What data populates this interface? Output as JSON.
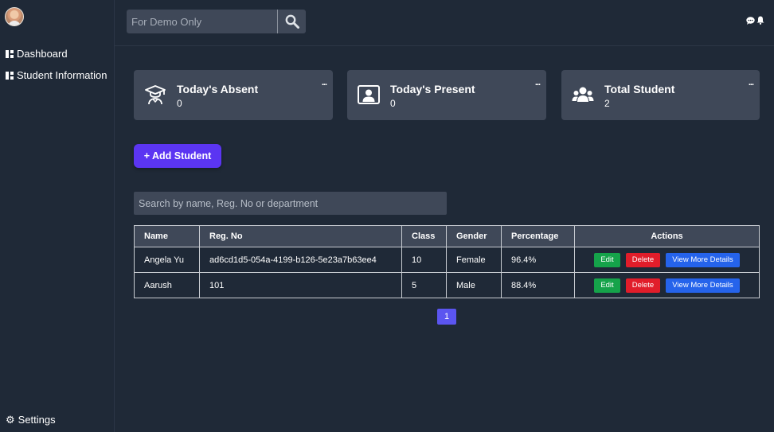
{
  "sidebar": {
    "items": [
      {
        "label": "Dashboard"
      },
      {
        "label": "Student Information"
      }
    ],
    "settings_label": "Settings"
  },
  "topbar": {
    "search_placeholder": "For Demo Only"
  },
  "cards": [
    {
      "title": "Today's Absent",
      "value": "0",
      "icon": "graduate-icon"
    },
    {
      "title": "Today's Present",
      "value": "0",
      "icon": "id-card-icon"
    },
    {
      "title": "Total Student",
      "value": "2",
      "icon": "users-icon"
    }
  ],
  "card_menu_label": "...",
  "add_student_label": "+ Add Student",
  "table_search_placeholder": "Search by name, Reg. No or department",
  "table": {
    "columns": [
      "Name",
      "Reg. No",
      "Class",
      "Gender",
      "Percentage",
      "Actions"
    ],
    "rows": [
      {
        "name": "Angela Yu",
        "reg": "ad6cd1d5-054a-4199-b126-5e23a7b63ee4",
        "class": "10",
        "gender": "Female",
        "percentage": "96.4%"
      },
      {
        "name": "Aarush",
        "reg": "101",
        "class": "5",
        "gender": "Male",
        "percentage": "88.4%"
      }
    ],
    "actions": {
      "edit": "Edit",
      "delete": "Delete",
      "view": "View More Details"
    }
  },
  "pagination": {
    "current": "1"
  },
  "colors": {
    "background": "#1f2937",
    "card": "#3f4858",
    "accent": "#5b35f2",
    "edit": "#15a34a",
    "delete": "#e11d2a",
    "view": "#2563eb"
  }
}
